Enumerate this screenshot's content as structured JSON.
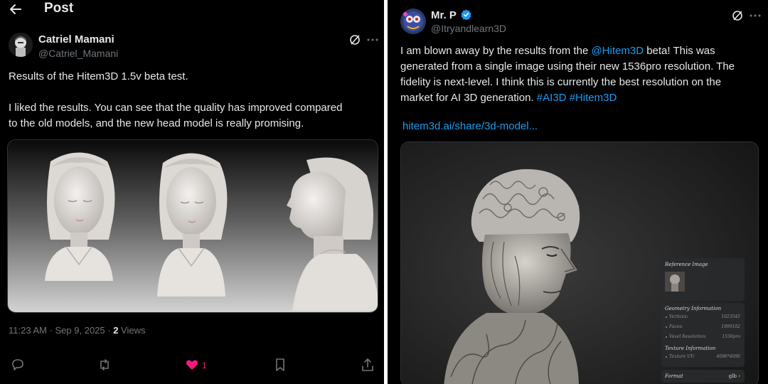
{
  "left_post": {
    "header_title": "Post",
    "author_name": "Catriel Mamani",
    "author_handle": "@Catriel_Mamani",
    "text_line1": "Results of the Hitem3D 1.5v beta test.",
    "text_line2": "I liked the results. You can see that the quality has improved compared",
    "text_line3": "to the old models, and the new head model is really promising.",
    "timestamp": "11:23 AM · Sep 9, 2025 · ",
    "views_count": "2",
    "views_label": " Views",
    "likes_count": "1",
    "icons": [
      "back-arrow-icon",
      "grok-icon",
      "more-icon",
      "reply-icon",
      "repost-icon",
      "heart-icon",
      "bookmark-icon",
      "share-icon"
    ],
    "like_color": "#f91880"
  },
  "right_post": {
    "author_name": "Mr. P",
    "author_handle": "@Itryandlearn3D",
    "verified": true,
    "text_lines": [
      {
        "before": "I am blown away by the results from the ",
        "mention": "@Hitem3D",
        "after": " beta! This was"
      },
      {
        "plain": "generated from a single image using their new 1536pro resolution. The"
      },
      {
        "plain": "fidelity is next-level. I think this is currently the best resolution on the"
      },
      {
        "before": "market for AI 3D generation. ",
        "tags": "#AI3D #Hitem3D"
      }
    ],
    "link_text": "hitem3d.ai/share/3d-model...",
    "link_color": "#1d9bf0",
    "app_panel": {
      "reference_title": "Reference Image",
      "geometry_title": "Geometry Information",
      "vertices_label": "Vertices:",
      "vertices_value": "1023545",
      "faces_label": "Faces:",
      "faces_value": "1999182",
      "resolution_label": "Voxel Resolution:",
      "resolution_value": "1536pro",
      "texture_title": "Texture Information",
      "texture_label": "Texture UV:",
      "texture_value": "4096*4096",
      "format_label": "Format",
      "format_value": "glb"
    }
  }
}
